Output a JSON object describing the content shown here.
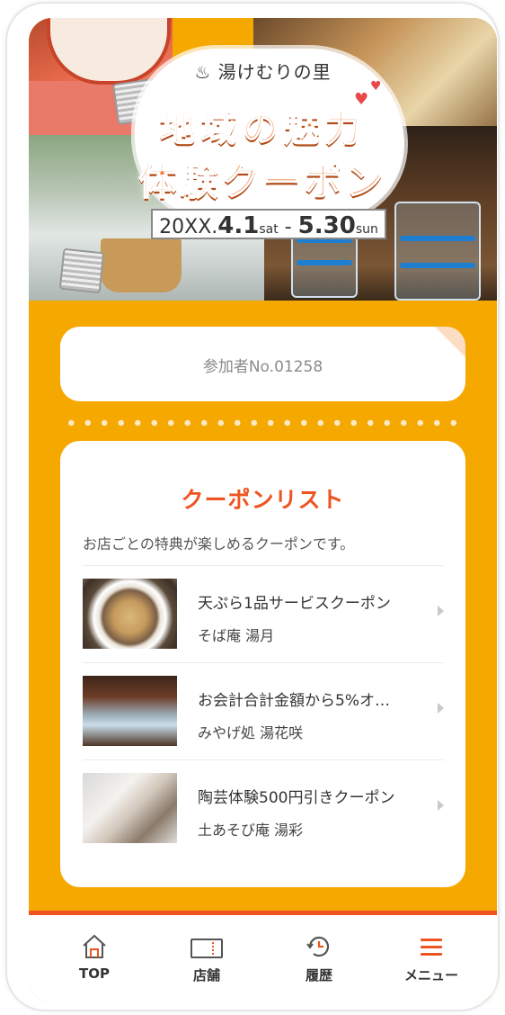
{
  "hero": {
    "subtitle": "♨ 湯けむりの里",
    "title_line1": "地域の魅力",
    "title_line2": "体験クーポン",
    "date_prefix": "20XX.",
    "date_start": "4.1",
    "date_start_day": "sat",
    "date_sep": " - ",
    "date_end": "5.30",
    "date_end_day": "sun"
  },
  "participant": {
    "label": "参加者No.01258"
  },
  "coupon_list": {
    "title": "クーポンリスト",
    "description": "お店ごとの特典が楽しめるクーポンです。",
    "items": [
      {
        "name": "天ぷら1品サービスクーポン",
        "shop": "そば庵 湯月",
        "image": "tempura-soba-photo"
      },
      {
        "name": "お会計合計金額から5%オ…",
        "shop": "みやげ処 湯花咲",
        "image": "glass-cups-photo"
      },
      {
        "name": "陶芸体験500円引きクーポン",
        "shop": "土あそび庵 湯彩",
        "image": "pottery-photo"
      }
    ]
  },
  "nav": {
    "items": [
      {
        "label": "TOP",
        "icon": "home-icon"
      },
      {
        "label": "店舗",
        "icon": "store-icon"
      },
      {
        "label": "履歴",
        "icon": "history-icon"
      },
      {
        "label": "メニュー",
        "icon": "menu-icon"
      }
    ]
  },
  "colors": {
    "background": "#f5a800",
    "accent": "#ee5420",
    "card": "#ffffff"
  }
}
